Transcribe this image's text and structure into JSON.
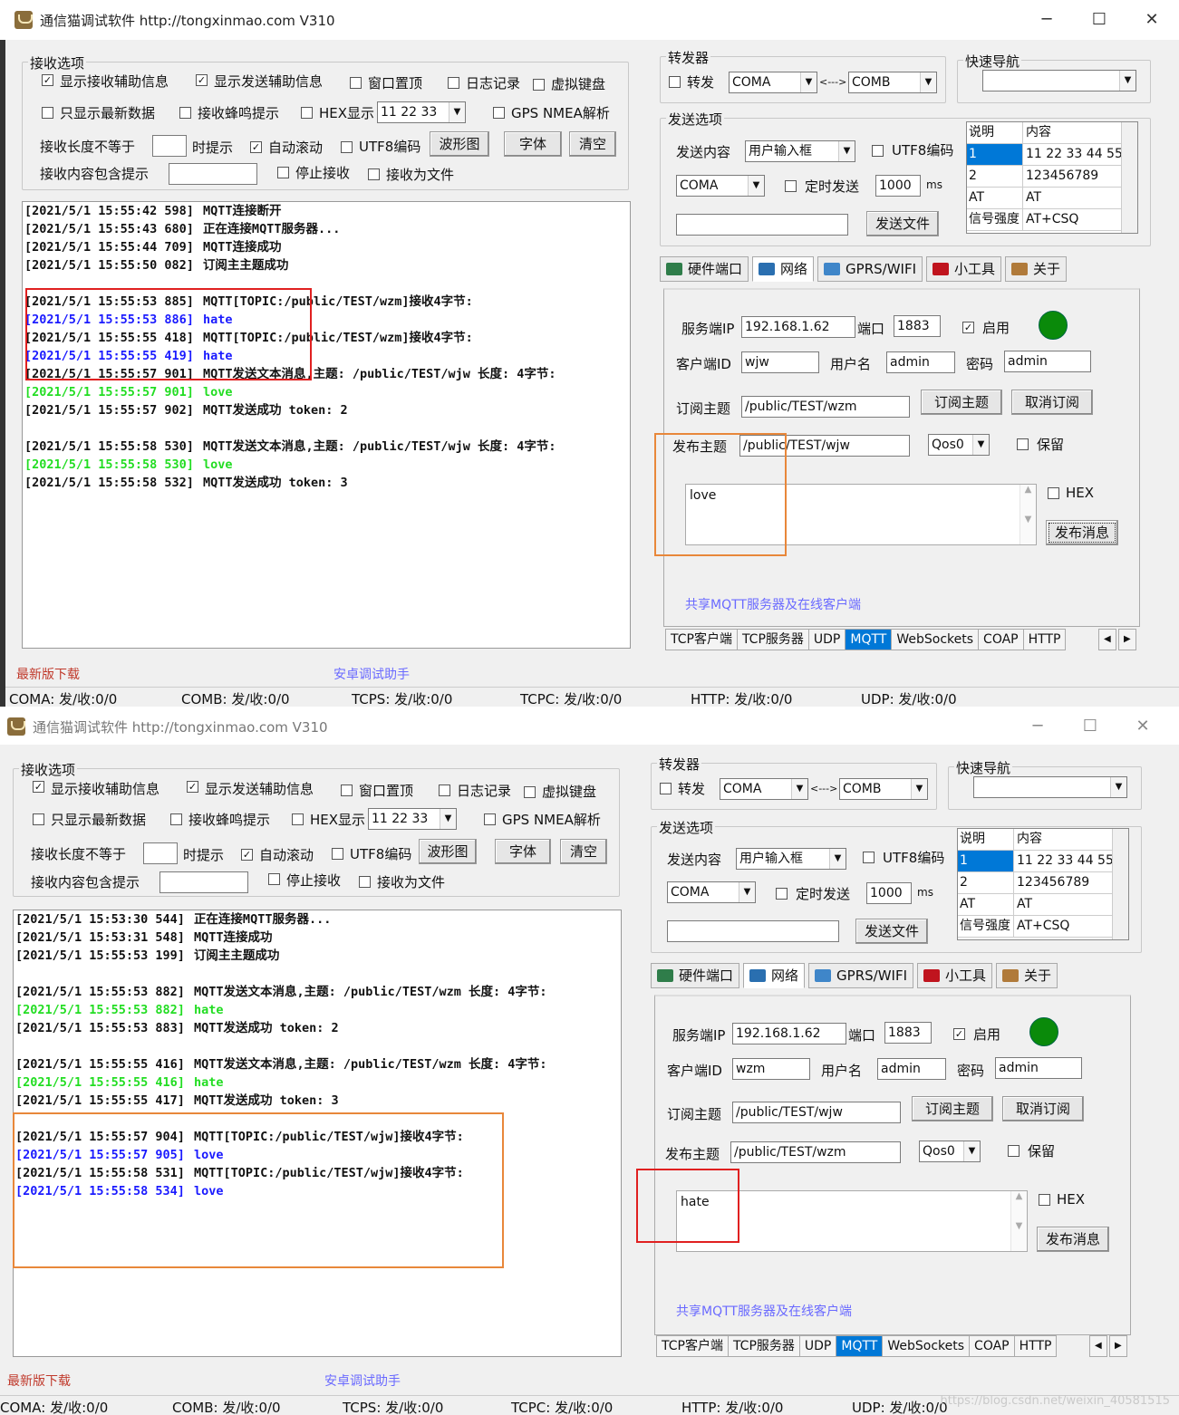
{
  "colors": {
    "accent": "#0078d7",
    "log_blue": "#1a1aff",
    "log_green": "#22dd22",
    "highlight_red": "#e02020",
    "highlight_orange": "#e8873a",
    "online": "#0a8a0a"
  },
  "win1": {
    "title": "通信猫调试软件  http://tongxinmao.com  V310",
    "recv_opts": {
      "legend": "接收选项",
      "show_recv_aux": "显示接收辅助信息",
      "show_send_aux": "显示发送辅助信息",
      "win_top": "窗口置顶",
      "log_record": "日志记录",
      "virtual_kb": "虚拟键盘",
      "only_latest": "只显示最新数据",
      "beep": "接收蜂鸣提示",
      "hex_show": "HEX显示",
      "hex_value": "11 22 33",
      "gps": "GPS NMEA解析",
      "len_ne": "接收长度不等于",
      "time_hint": "时提示",
      "auto_scroll": "自动滚动",
      "utf8": "UTF8编码",
      "wave": "波形图",
      "font": "字体",
      "clear": "清空",
      "contains": "接收内容包含提示",
      "stop_recv": "停止接收",
      "recv_file": "接收为文件"
    },
    "log": [
      {
        "t": "[2021/5/1 15:55:42 598]",
        "m": "MQTT连接断开",
        "c": "black"
      },
      {
        "t": "[2021/5/1 15:55:43 680]",
        "m": "正在连接MQTT服务器...",
        "c": "black"
      },
      {
        "t": "[2021/5/1 15:55:44 709]",
        "m": "MQTT连接成功",
        "c": "black"
      },
      {
        "t": "[2021/5/1 15:55:50 082]",
        "m": "订阅主主题成功",
        "c": "black"
      },
      {
        "t": "",
        "m": "",
        "c": "black"
      },
      {
        "t": "[2021/5/1 15:55:53 885]",
        "m": "MQTT[TOPIC:/public/TEST/wzm]接收4字节:",
        "c": "black"
      },
      {
        "t": "[2021/5/1 15:55:53 886]",
        "m": "hate",
        "c": "blue"
      },
      {
        "t": "[2021/5/1 15:55:55 418]",
        "m": "MQTT[TOPIC:/public/TEST/wzm]接收4字节:",
        "c": "black"
      },
      {
        "t": "[2021/5/1 15:55:55 419]",
        "m": "hate",
        "c": "blue"
      },
      {
        "t": "[2021/5/1 15:55:57 901]",
        "m": "MQTT发送文本消息,主题: /public/TEST/wjw 长度: 4字节:",
        "c": "black"
      },
      {
        "t": "[2021/5/1 15:55:57 901]",
        "m": "love",
        "c": "green"
      },
      {
        "t": "[2021/5/1 15:55:57 902]",
        "m": "MQTT发送成功 token: 2",
        "c": "black"
      },
      {
        "t": "",
        "m": "",
        "c": "black"
      },
      {
        "t": "[2021/5/1 15:55:58 530]",
        "m": "MQTT发送文本消息,主题: /public/TEST/wjw 长度: 4字节:",
        "c": "black"
      },
      {
        "t": "[2021/5/1 15:55:58 530]",
        "m": "love",
        "c": "green"
      },
      {
        "t": "[2021/5/1 15:55:58 532]",
        "m": "MQTT发送成功 token: 3",
        "c": "black"
      }
    ],
    "fwd": {
      "legend": "转发器",
      "forward": "转发",
      "port_a": "COMA",
      "arrow": "<--->",
      "port_b": "COMB"
    },
    "nav": {
      "legend": "快速导航",
      "value": ""
    },
    "send": {
      "legend": "发送选项",
      "content_label": "发送内容",
      "content_mode": "用户输入框",
      "utf8": "UTF8编码",
      "port": "COMA",
      "timed": "定时发送",
      "interval": "1000",
      "ms": "ms",
      "send_file": "发送文件",
      "input": ""
    },
    "table": {
      "h1": "说明",
      "h2": "内容",
      "rows": [
        [
          "1",
          "11 22 33 44 55"
        ],
        [
          "2",
          "123456789"
        ],
        [
          "AT",
          "AT"
        ],
        [
          "信号强度",
          "AT+CSQ"
        ]
      ]
    },
    "tabs": [
      "硬件端口",
      "网络",
      "GPRS/WIFI",
      "小工具",
      "关于"
    ],
    "mqtt": {
      "server_ip_label": "服务端IP",
      "server_ip": "192.168.1.62",
      "port_label": "端口",
      "port": "1883",
      "enable": "启用",
      "client_id_label": "客户端ID",
      "client_id": "wjw",
      "user_label": "用户名",
      "user": "admin",
      "pass_label": "密码",
      "pass": "admin",
      "sub_label": "订阅主题",
      "sub_topic": "/public/TEST/wzm",
      "sub_btn": "订阅主题",
      "unsub_btn": "取消订阅",
      "pub_label": "发布主题",
      "pub_topic": "/public/TEST/wjw",
      "qos": "Qos0",
      "retain": "保留",
      "message": "love",
      "hex": "HEX",
      "publish_btn": "发布消息",
      "share_link": "共享MQTT服务器及在线客户端"
    },
    "proto_tabs": [
      "TCP客户端",
      "TCP服务器",
      "UDP",
      "MQTT",
      "WebSockets",
      "COAP",
      "HTTP"
    ],
    "download": "最新版下载",
    "android": "安卓调试助手",
    "status": [
      "COMA: 发/收:0/0",
      "COMB: 发/收:0/0",
      "TCPS: 发/收:0/0",
      "TCPC: 发/收:0/0",
      "HTTP: 发/收:0/0",
      "UDP: 发/收:0/0"
    ]
  },
  "win2": {
    "title": "通信猫调试软件  http://tongxinmao.com  V310",
    "recv_opts": {
      "legend": "接收选项",
      "show_recv_aux": "显示接收辅助信息",
      "show_send_aux": "显示发送辅助信息",
      "win_top": "窗口置顶",
      "log_record": "日志记录",
      "virtual_kb": "虚拟键盘",
      "only_latest": "只显示最新数据",
      "beep": "接收蜂鸣提示",
      "hex_show": "HEX显示",
      "hex_value": "11 22 33",
      "gps": "GPS NMEA解析",
      "len_ne": "接收长度不等于",
      "time_hint": "时提示",
      "auto_scroll": "自动滚动",
      "utf8": "UTF8编码",
      "wave": "波形图",
      "font": "字体",
      "clear": "清空",
      "contains": "接收内容包含提示",
      "stop_recv": "停止接收",
      "recv_file": "接收为文件"
    },
    "log": [
      {
        "t": "[2021/5/1 15:53:30 544]",
        "m": "正在连接MQTT服务器...",
        "c": "black"
      },
      {
        "t": "[2021/5/1 15:53:31 548]",
        "m": "MQTT连接成功",
        "c": "black"
      },
      {
        "t": "[2021/5/1 15:55:53 199]",
        "m": "订阅主主题成功",
        "c": "black"
      },
      {
        "t": "",
        "m": "",
        "c": "black"
      },
      {
        "t": "[2021/5/1 15:55:53 882]",
        "m": "MQTT发送文本消息,主题: /public/TEST/wzm 长度: 4字节:",
        "c": "black"
      },
      {
        "t": "[2021/5/1 15:55:53 882]",
        "m": "hate",
        "c": "green"
      },
      {
        "t": "[2021/5/1 15:55:53 883]",
        "m": "MQTT发送成功 token: 2",
        "c": "black"
      },
      {
        "t": "",
        "m": "",
        "c": "black"
      },
      {
        "t": "[2021/5/1 15:55:55 416]",
        "m": "MQTT发送文本消息,主题: /public/TEST/wzm 长度: 4字节:",
        "c": "black"
      },
      {
        "t": "[2021/5/1 15:55:55 416]",
        "m": "hate",
        "c": "green"
      },
      {
        "t": "[2021/5/1 15:55:55 417]",
        "m": "MQTT发送成功 token: 3",
        "c": "black"
      },
      {
        "t": "",
        "m": "",
        "c": "black"
      },
      {
        "t": "[2021/5/1 15:55:57 904]",
        "m": "MQTT[TOPIC:/public/TEST/wjw]接收4字节:",
        "c": "black"
      },
      {
        "t": "[2021/5/1 15:55:57 905]",
        "m": "love",
        "c": "blue"
      },
      {
        "t": "[2021/5/1 15:55:58 531]",
        "m": "MQTT[TOPIC:/public/TEST/wjw]接收4字节:",
        "c": "black"
      },
      {
        "t": "[2021/5/1 15:55:58 534]",
        "m": "love",
        "c": "blue"
      }
    ],
    "fwd": {
      "legend": "转发器",
      "forward": "转发",
      "port_a": "COMA",
      "arrow": "<--->",
      "port_b": "COMB"
    },
    "nav": {
      "legend": "快速导航",
      "value": ""
    },
    "send": {
      "legend": "发送选项",
      "content_label": "发送内容",
      "content_mode": "用户输入框",
      "utf8": "UTF8编码",
      "port": "COMA",
      "timed": "定时发送",
      "interval": "1000",
      "ms": "ms",
      "send_file": "发送文件",
      "input": ""
    },
    "table": {
      "h1": "说明",
      "h2": "内容",
      "rows": [
        [
          "1",
          "11 22 33 44 55"
        ],
        [
          "2",
          "123456789"
        ],
        [
          "AT",
          "AT"
        ],
        [
          "信号强度",
          "AT+CSQ"
        ]
      ]
    },
    "tabs": [
      "硬件端口",
      "网络",
      "GPRS/WIFI",
      "小工具",
      "关于"
    ],
    "mqtt": {
      "server_ip_label": "服务端IP",
      "server_ip": "192.168.1.62",
      "port_label": "端口",
      "port": "1883",
      "enable": "启用",
      "client_id_label": "客户端ID",
      "client_id": "wzm",
      "user_label": "用户名",
      "user": "admin",
      "pass_label": "密码",
      "pass": "admin",
      "sub_label": "订阅主题",
      "sub_topic": "/public/TEST/wjw",
      "sub_btn": "订阅主题",
      "unsub_btn": "取消订阅",
      "pub_label": "发布主题",
      "pub_topic": "/public/TEST/wzm",
      "qos": "Qos0",
      "retain": "保留",
      "message": "hate",
      "hex": "HEX",
      "publish_btn": "发布消息",
      "share_link": "共享MQTT服务器及在线客户端"
    },
    "proto_tabs": [
      "TCP客户端",
      "TCP服务器",
      "UDP",
      "MQTT",
      "WebSockets",
      "COAP",
      "HTTP"
    ],
    "download": "最新版下载",
    "android": "安卓调试助手",
    "status": [
      "COMA: 发/收:0/0",
      "COMB: 发/收:0/0",
      "TCPS: 发/收:0/0",
      "TCPC: 发/收:0/0",
      "HTTP: 发/收:0/0",
      "UDP: 发/收:0/0"
    ]
  },
  "watermark": "https://blog.csdn.net/weixin_40581515"
}
